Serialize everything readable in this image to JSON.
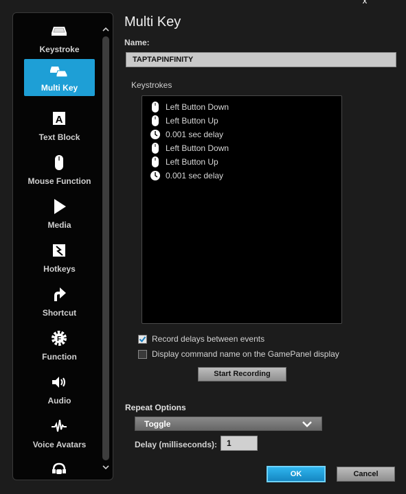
{
  "window": {
    "close_glyph": "x"
  },
  "sidebar": {
    "items": [
      {
        "label": "Keystroke",
        "icon": "keycap-icon"
      },
      {
        "label": "Multi Key",
        "icon": "multi-keycap-icon",
        "active": true
      },
      {
        "label": "Text Block",
        "icon": "text-block-icon"
      },
      {
        "label": "Mouse Function",
        "icon": "mouse-icon"
      },
      {
        "label": "Media",
        "icon": "play-icon"
      },
      {
        "label": "Hotkeys",
        "icon": "hotkey-icon"
      },
      {
        "label": "Shortcut",
        "icon": "shortcut-arrow-icon"
      },
      {
        "label": "Function",
        "icon": "gear-f-icon"
      },
      {
        "label": "Audio",
        "icon": "speaker-icon"
      },
      {
        "label": "Voice Avatars",
        "icon": "waveform-icon"
      },
      {
        "label": "",
        "icon": "headset-avatar-icon"
      }
    ]
  },
  "main": {
    "title": "Multi Key",
    "name_label": "Name:",
    "name_value": "TAPTAPINFINITY",
    "keystrokes_label": "Keystrokes",
    "keystrokes": [
      {
        "icon": "mouse-icon",
        "text": "Left Button Down"
      },
      {
        "icon": "mouse-icon",
        "text": "Left Button Up"
      },
      {
        "icon": "clock-icon",
        "text": "0.001 sec delay"
      },
      {
        "icon": "mouse-icon",
        "text": "Left Button Down"
      },
      {
        "icon": "mouse-icon",
        "text": "Left Button Up"
      },
      {
        "icon": "clock-icon",
        "text": "0.001 sec delay"
      }
    ],
    "record_delays": {
      "label": "Record delays between events",
      "checked": true
    },
    "display_command": {
      "label": "Display command name on the GamePanel display",
      "checked": false
    },
    "start_recording": "Start Recording",
    "repeat_options_label": "Repeat Options",
    "repeat_selected": "Toggle",
    "delay_label": "Delay (milliseconds):",
    "delay_value": "1",
    "ok": "OK",
    "cancel": "Cancel"
  },
  "colors": {
    "accent": "#1e9fd6",
    "background": "#1c1c1c",
    "panel": "#000000"
  }
}
